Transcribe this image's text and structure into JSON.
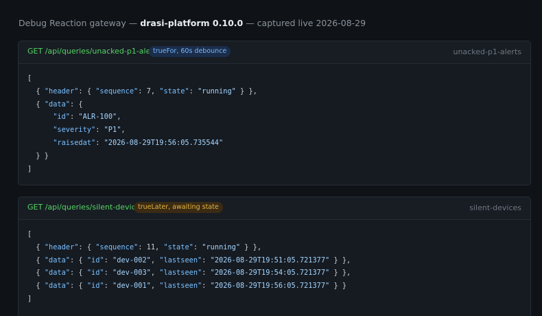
{
  "caption": {
    "prefix": "Debug Reaction gateway — ",
    "product": "drasi-platform 0.10.0",
    "suffix": " — captured live 2026-08-29"
  },
  "panels": [
    {
      "method_path": "GET /api/queries/unacked-p1-alerts",
      "badge": "trueFor, 60s debounce",
      "badge_color": "#79b8ff",
      "name": "unacked-p1-alerts",
      "lines": [
        "[",
        "  { \"header\": { \"sequence\": 7, \"state\": \"running\" } },",
        "  { \"data\": {",
        "      \"id\": \"ALR-100\",",
        "      \"severity\": \"P1\",",
        "      \"raisedat\": \"2026-08-29T19:56:05.735544\"",
        "  } }",
        "]"
      ]
    },
    {
      "method_path": "GET /api/queries/silent-devices",
      "badge": "trueLater, awaiting state",
      "badge_color": "#e3b341",
      "name": "silent-devices",
      "lines": [
        "[",
        "  { \"header\": { \"sequence\": 11, \"state\": \"running\" } },",
        "  { \"data\": { \"id\": \"dev-002\", \"lastseen\": \"2026-08-29T19:51:05.721377\" } },",
        "  { \"data\": { \"id\": \"dev-003\", \"lastseen\": \"2026-08-29T19:54:05.721377\" } },",
        "  { \"data\": { \"id\": \"dev-001\", \"lastseen\": \"2026-08-29T19:56:05.721377\" } }",
        "]"
      ]
    }
  ]
}
